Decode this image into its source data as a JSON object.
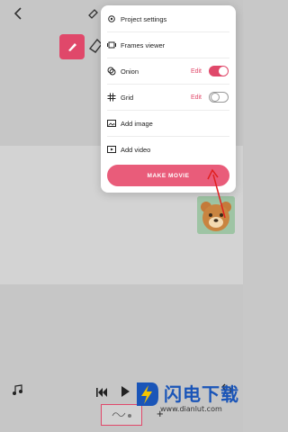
{
  "menu": {
    "items": [
      {
        "label": "Project settings",
        "icon": "gear-icon"
      },
      {
        "label": "Frames viewer",
        "icon": "frames-icon"
      },
      {
        "label": "Onion",
        "icon": "onion-icon",
        "edit": "Edit",
        "toggle": true
      },
      {
        "label": "Grid",
        "icon": "grid-icon",
        "edit": "Edit",
        "toggle": false
      },
      {
        "label": "Add image",
        "icon": "image-icon"
      },
      {
        "label": "Add video",
        "icon": "video-icon"
      }
    ],
    "make_movie_label": "MAKE MOVIE"
  },
  "timeline": {
    "add_frame_label": "+"
  },
  "watermark": {
    "cn_text": "闪电下载",
    "url": "www.dianlut.com"
  },
  "colors": {
    "accent": "#e0486a",
    "button": "#e95c7a",
    "overlay": "#c6c6c6"
  }
}
